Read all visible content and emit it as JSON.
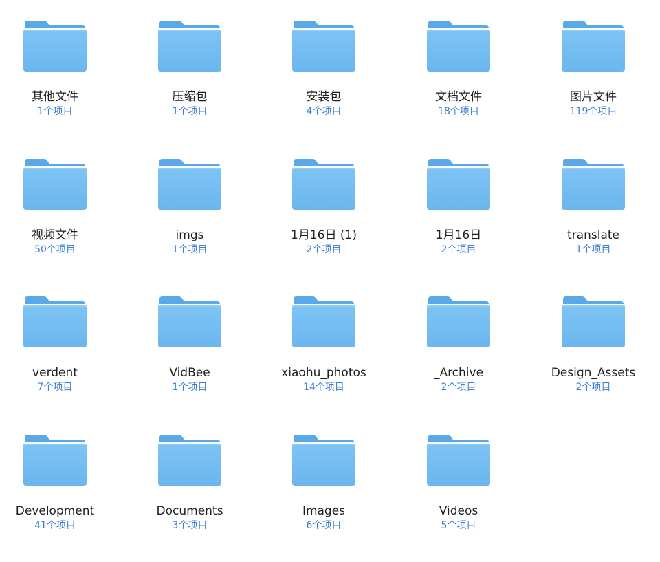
{
  "colors": {
    "folder_back": "#5aa9e6",
    "folder_front": "#7ec4f5",
    "folder_tab": "#5aa9e6",
    "name_text": "#1f1f1f",
    "count_text": "#3d7fd6"
  },
  "folders": [
    {
      "name": "其他文件",
      "count": "1个项目",
      "icon": "folder-icon"
    },
    {
      "name": "压缩包",
      "count": "1个项目",
      "icon": "folder-icon"
    },
    {
      "name": "安装包",
      "count": "4个项目",
      "icon": "folder-icon"
    },
    {
      "name": "文档文件",
      "count": "18个项目",
      "icon": "folder-icon"
    },
    {
      "name": "图片文件",
      "count": "119个项目",
      "icon": "folder-icon"
    },
    {
      "name": "视频文件",
      "count": "50个项目",
      "icon": "folder-icon"
    },
    {
      "name": "imgs",
      "count": "1个项目",
      "icon": "folder-icon"
    },
    {
      "name": "1月16日 (1)",
      "count": "2个项目",
      "icon": "folder-icon"
    },
    {
      "name": "1月16日",
      "count": "2个项目",
      "icon": "folder-icon"
    },
    {
      "name": "translate",
      "count": "1个项目",
      "icon": "folder-icon"
    },
    {
      "name": "verdent",
      "count": "7个项目",
      "icon": "folder-icon"
    },
    {
      "name": "VidBee",
      "count": "1个项目",
      "icon": "folder-icon"
    },
    {
      "name": "xiaohu_photos",
      "count": "14个项目",
      "icon": "folder-icon"
    },
    {
      "name": "_Archive",
      "count": "2个项目",
      "icon": "folder-icon"
    },
    {
      "name": "Design_Assets",
      "count": "2个项目",
      "icon": "folder-icon"
    },
    {
      "name": "Development",
      "count": "41个项目",
      "icon": "folder-icon"
    },
    {
      "name": "Documents",
      "count": "3个项目",
      "icon": "folder-icon"
    },
    {
      "name": "Images",
      "count": "6个项目",
      "icon": "folder-icon"
    },
    {
      "name": "Videos",
      "count": "5个项目",
      "icon": "folder-icon"
    }
  ]
}
